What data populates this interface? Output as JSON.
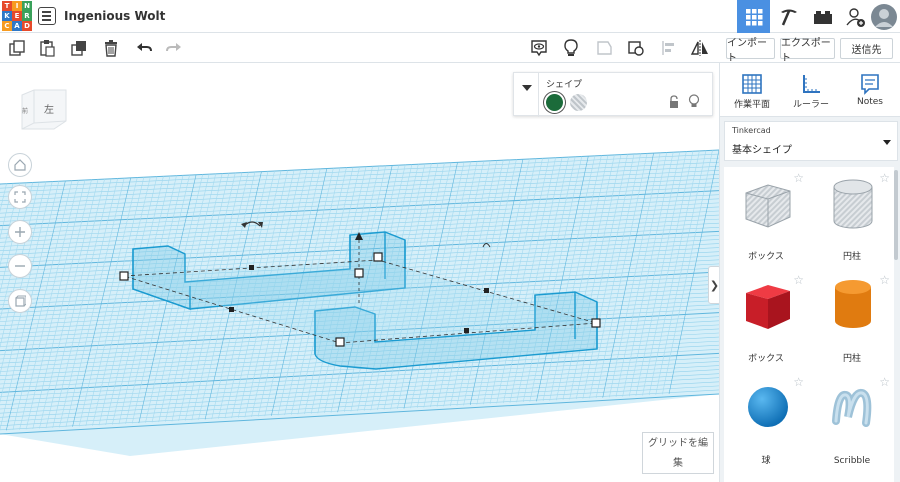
{
  "app": {
    "logo_letters": [
      "T",
      "I",
      "N",
      "K",
      "E",
      "R",
      "C",
      "A",
      "D"
    ],
    "logo_colors": [
      "#e64a2b",
      "#f79b20",
      "#3aa15b",
      "#2e78c8",
      "#e64a2b",
      "#3aa15b",
      "#f79b20",
      "#2e78c8",
      "#e64a2b"
    ],
    "project_title": "Ingenious Wolt"
  },
  "header": {
    "view_buttons": [
      {
        "icon": "grid-view-icon",
        "active": true
      },
      {
        "icon": "pickaxe-icon",
        "active": false
      },
      {
        "icon": "bricks-icon",
        "active": false
      },
      {
        "icon": "add-user-icon",
        "active": false
      },
      {
        "icon": "avatar",
        "active": false
      }
    ]
  },
  "toolbar": {
    "tools": [
      "copy-icon",
      "paste-icon",
      "duplicate-icon",
      "trash-icon",
      "undo-icon",
      "redo-icon"
    ],
    "right_tools": [
      "show-all-icon",
      "light-bulb-icon",
      "group-icon",
      "ungroup-icon",
      "align-icon",
      "mirror-icon"
    ],
    "import_label": "インポート",
    "export_label": "エクスポート",
    "send_label": "送信先"
  },
  "canvas": {
    "viewcube_label": "左",
    "nav_buttons": [
      "home-icon",
      "fit-icon",
      "zoom-in-icon",
      "zoom-out-icon",
      "perspective-icon"
    ],
    "grid_edit_line1": "グリッドを編",
    "grid_edit_line2": "集"
  },
  "shape_panel": {
    "title": "シェイプ",
    "solid_color": "#1b6b3a",
    "hole_label": "hole"
  },
  "right_panel": {
    "tabs": [
      {
        "icon": "workplane-icon",
        "label": "作業平面"
      },
      {
        "icon": "ruler-icon",
        "label": "ルーラー"
      },
      {
        "icon": "notes-icon",
        "label": "Notes"
      }
    ],
    "library_caption": "Tinkercad",
    "library_value": "基本シェイプ",
    "shapes": [
      {
        "icon": "box-hole-icon",
        "label": "ボックス"
      },
      {
        "icon": "cylinder-hole-icon",
        "label": "円柱"
      },
      {
        "icon": "box-icon",
        "label": "ボックス"
      },
      {
        "icon": "cylinder-icon",
        "label": "円柱"
      },
      {
        "icon": "sphere-icon",
        "label": "球"
      },
      {
        "icon": "scribble-icon",
        "label": "Scribble"
      }
    ]
  },
  "colors": {
    "accent": "#4a90e2",
    "box_red": "#d9232e",
    "cylinder_orange": "#f08a1c",
    "sphere_blue": "#1e88d0",
    "grid": "#8fd0ea"
  }
}
